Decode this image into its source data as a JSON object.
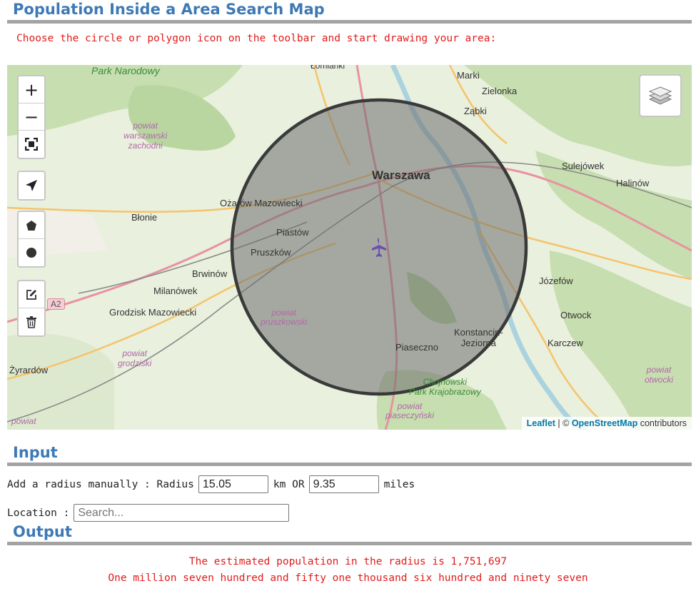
{
  "page": {
    "title": "Population Inside a Area Search Map",
    "instruction": "Choose the circle or polygon icon on the toolbar and start drawing your area:"
  },
  "map": {
    "zoom_in": "+",
    "zoom_out": "−",
    "attribution": {
      "leaflet": "Leaflet",
      "sep": " | © ",
      "osm": "OpenStreetMap",
      "suffix": " contributors"
    },
    "circle_fill": "#6e6e6e",
    "labels": {
      "park_narodowy": "Park Narodowy",
      "lomianki": "Łomianki",
      "marki": "Marki",
      "zielonka": "Zielonka",
      "zabki": "Ząbki",
      "powiat_warszawski_zachodni_1": "powiat",
      "powiat_warszawski_zachodni_2": "warszawski",
      "powiat_warszawski_zachodni_3": "zachodni",
      "warszawa": "Warszawa",
      "sulejowek": "Sulejówek",
      "halinow": "Halinów",
      "ozarow": "Ożarów Mazowiecki",
      "blonie": "Błonie",
      "piastow": "Piastów",
      "pruszkow": "Pruszków",
      "brwinow": "Brwinów",
      "milanowek": "Milanówek",
      "grodzisk": "Grodzisk Mazowiecki",
      "a2": "A2",
      "jozefow": "Józefów",
      "otwock": "Otwock",
      "konstancin_1": "Konstancin-",
      "konstancin_2": "Jeziorna",
      "karczew": "Karczew",
      "powiat_pruszkowski_1": "powiat",
      "powiat_pruszkowski_2": "pruszkowski",
      "piaseczno": "Piaseczno",
      "powiat_grodziski_1": "powiat",
      "powiat_grodziski_2": "grodziski",
      "zyrardow": "Żyrardów",
      "chojnowski_1": "Chojnowski",
      "chojnowski_2": "Park Krajobrazowy",
      "powiat_piaseczynski_1": "powiat",
      "powiat_piaseczynski_2": "piaseczyński",
      "powiat_otwocki_1": "powiat",
      "powiat_otwocki_2": "otwocki",
      "powiat_bottom": "powiat"
    }
  },
  "input": {
    "heading": "Input",
    "radius_label": "Add a radius manually : Radius",
    "radius_km": "15.05",
    "km_or": "km OR",
    "radius_miles": "9.35",
    "miles": "miles",
    "location_label": "Location :",
    "search_placeholder": "Search..."
  },
  "output": {
    "heading": "Output",
    "estimate_text": "The estimated population in the radius is 1,751,697",
    "words_text": "One million seven hundred and fifty one thousand six hundred and ninety seven"
  }
}
